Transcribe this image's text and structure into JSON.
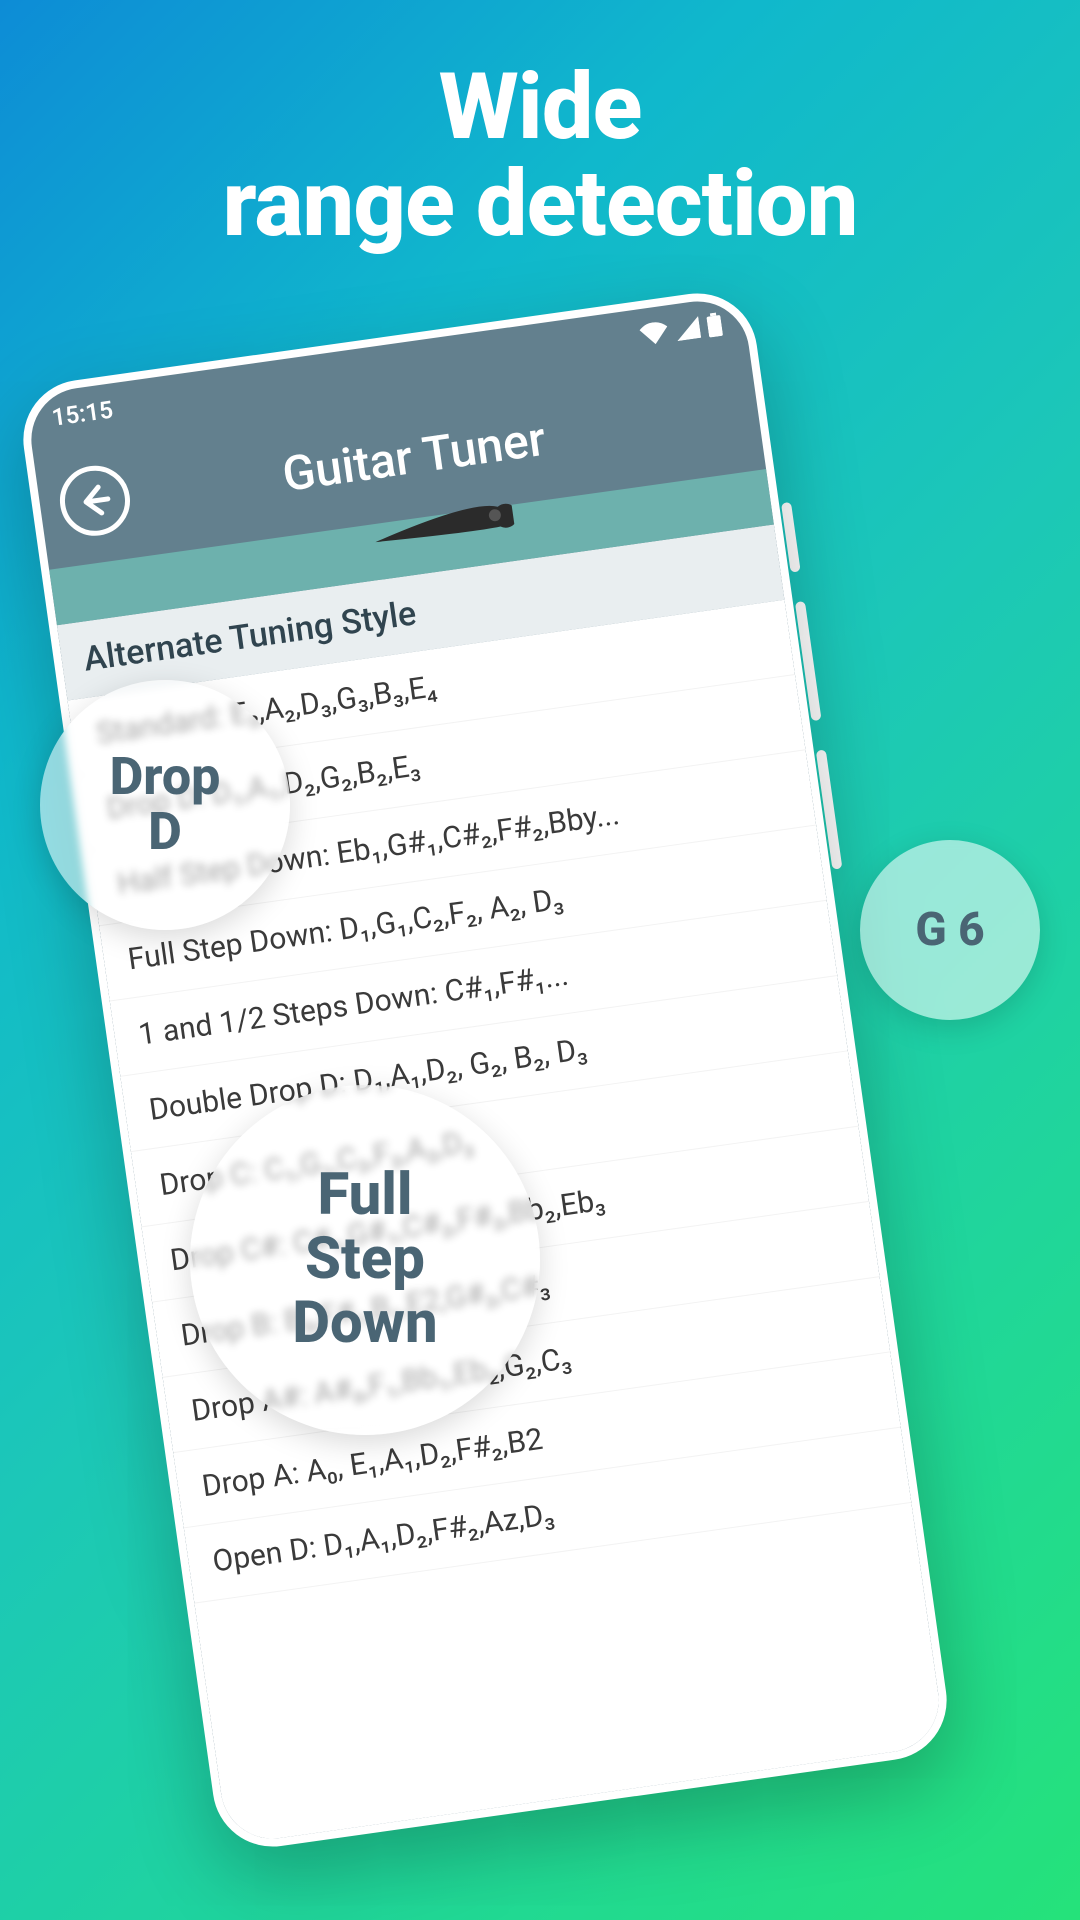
{
  "headline_line1": "Wide",
  "headline_line2": "range detection",
  "statusbar": {
    "time": "15:15"
  },
  "appbar": {
    "title": "Guitar Tuner"
  },
  "list_header": "Alternate Tuning Style",
  "tunings": [
    {
      "label": "Standard: E₂,A₂,D₃,G₃,B₃,E₄"
    },
    {
      "label": "Drop D: D₁,A₁,D₂,G₂,B₂,E₃"
    },
    {
      "label": "Half Step Down: Eb₁,G#₁,C#₂,F#₂,Bby..."
    },
    {
      "label": "Full Step Down: D₁,G₁,C₂,F₂, A₂, D₃"
    },
    {
      "label": "1 and 1/2 Steps Down: C#₁,F#₁..."
    },
    {
      "label": "Double Drop D: D₁,A₁,D₂, G₂, B₂, D₃"
    },
    {
      "label": "Drop C: C₁,G₁,C₂,F₂,A₂,D₃"
    },
    {
      "label": "Drop C#: C#₁,G#₁,C#₂,F#₂,Bb₂,Eb₃"
    },
    {
      "label": "Drop B: B₀,F#₁,B₁,E2,G#₂,C#₃"
    },
    {
      "label": "Drop A#: A#₀,F₁,Bb₁,Eb₂,G₂,C₃"
    },
    {
      "label": "Drop A: A₀, E₁,A₁,D₂,F#₂,B2"
    },
    {
      "label": "Open D: D₁,A₁,D₂,F#₂,Az,D₃"
    }
  ],
  "bubbles": {
    "drop_d": "Drop D",
    "g6": "G 6",
    "full_step": "Full Step Down"
  }
}
